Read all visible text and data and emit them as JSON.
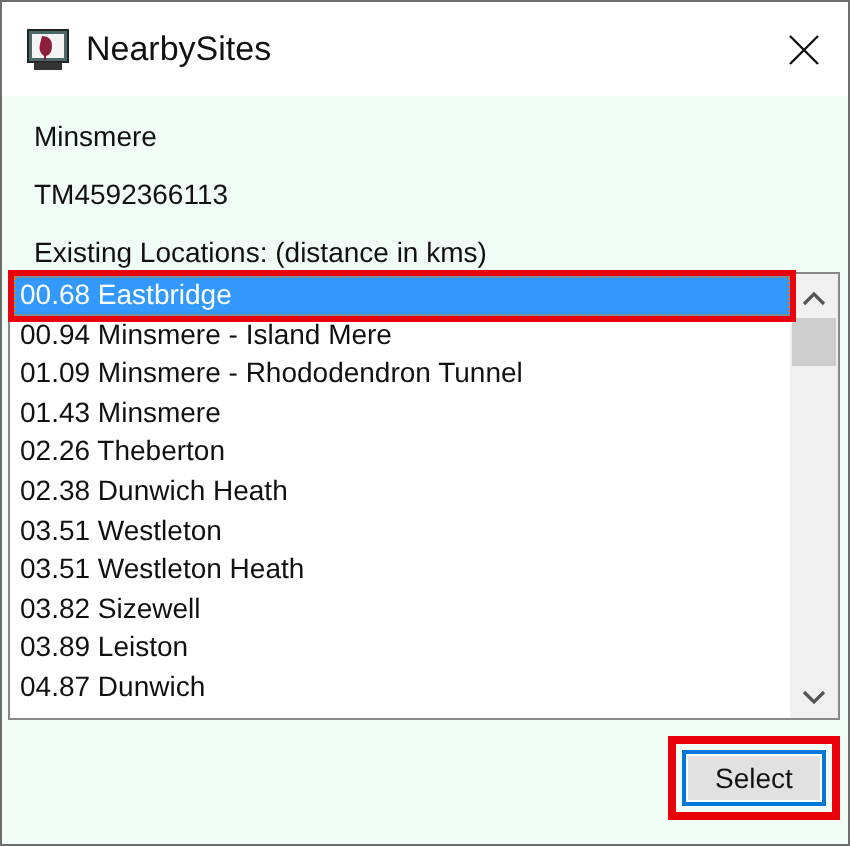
{
  "window": {
    "title": "NearbySites"
  },
  "site_name": "Minsmere",
  "grid_reference": "TM4592366113",
  "list_label": "Existing Locations: (distance in kms)",
  "locations": [
    {
      "label": "00.68 Eastbridge",
      "selected": true,
      "highlighted": true
    },
    {
      "label": "00.94 Minsmere - Island Mere",
      "selected": false,
      "highlighted": false
    },
    {
      "label": "01.09 Minsmere - Rhododendron Tunnel",
      "selected": false,
      "highlighted": false
    },
    {
      "label": "01.43 Minsmere",
      "selected": false,
      "highlighted": false
    },
    {
      "label": "02.26 Theberton",
      "selected": false,
      "highlighted": false
    },
    {
      "label": "02.38 Dunwich Heath",
      "selected": false,
      "highlighted": false
    },
    {
      "label": "03.51 Westleton",
      "selected": false,
      "highlighted": false
    },
    {
      "label": "03.51 Westleton Heath",
      "selected": false,
      "highlighted": false
    },
    {
      "label": "03.82 Sizewell",
      "selected": false,
      "highlighted": false
    },
    {
      "label": "03.89 Leiston",
      "selected": false,
      "highlighted": false
    },
    {
      "label": "04.87 Dunwich",
      "selected": false,
      "highlighted": false
    }
  ],
  "select_button": {
    "label": "Select",
    "highlighted": true
  }
}
